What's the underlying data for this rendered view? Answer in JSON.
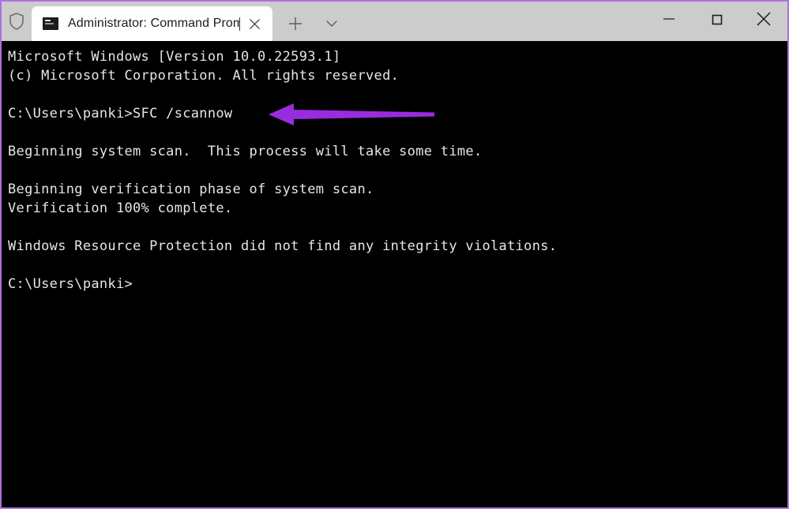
{
  "window": {
    "border_color": "#b070dd",
    "titlebar_bg": "#cccccc",
    "terminal_bg": "#000000",
    "terminal_fg": "#e6e6e6"
  },
  "titlebar": {
    "shield_icon": "shield-icon",
    "tab": {
      "icon": "console-icon",
      "title": "Administrator: Command Prom",
      "close_label": "✕"
    },
    "new_tab_label": "+",
    "dropdown_label": "⌄",
    "minimize_label": "—",
    "maximize_label": "□",
    "close_label": "✕"
  },
  "terminal": {
    "lines": [
      "Microsoft Windows [Version 10.0.22593.1]",
      "(c) Microsoft Corporation. All rights reserved.",
      "",
      "C:\\Users\\panki>SFC /scannow",
      "",
      "Beginning system scan.  This process will take some time.",
      "",
      "Beginning verification phase of system scan.",
      "Verification 100% complete.",
      "",
      "Windows Resource Protection did not find any integrity violations.",
      "",
      "C:\\Users\\panki>"
    ]
  },
  "annotation": {
    "arrow_color": "#9a2ce0",
    "arrow_direction": "left",
    "points_at": "SFC /scannow"
  }
}
